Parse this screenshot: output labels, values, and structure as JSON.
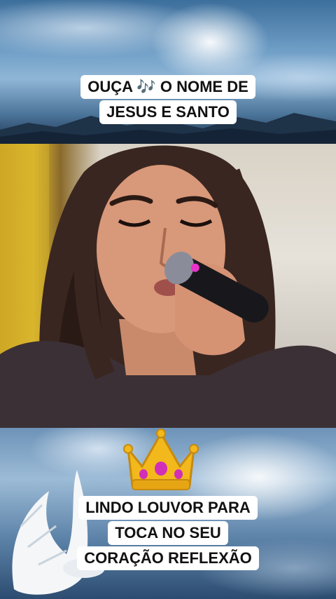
{
  "top_caption": {
    "line1_pre": "OUÇA",
    "line1_emoji": "🎶",
    "line1_post": "O NOME DE",
    "line2": "JESUS E SANTO"
  },
  "bottom_caption": {
    "line1": "LINDO LOUVOR PARA",
    "line2": "TOCA NO SEU",
    "line3": "CORAÇÃO REFLEXÃO"
  },
  "crown_icon": "crown-icon",
  "colors": {
    "caption_bg": "#ffffff",
    "caption_text": "#111111",
    "crown_gold": "#f2b81c",
    "crown_gem": "#d22fb8"
  }
}
